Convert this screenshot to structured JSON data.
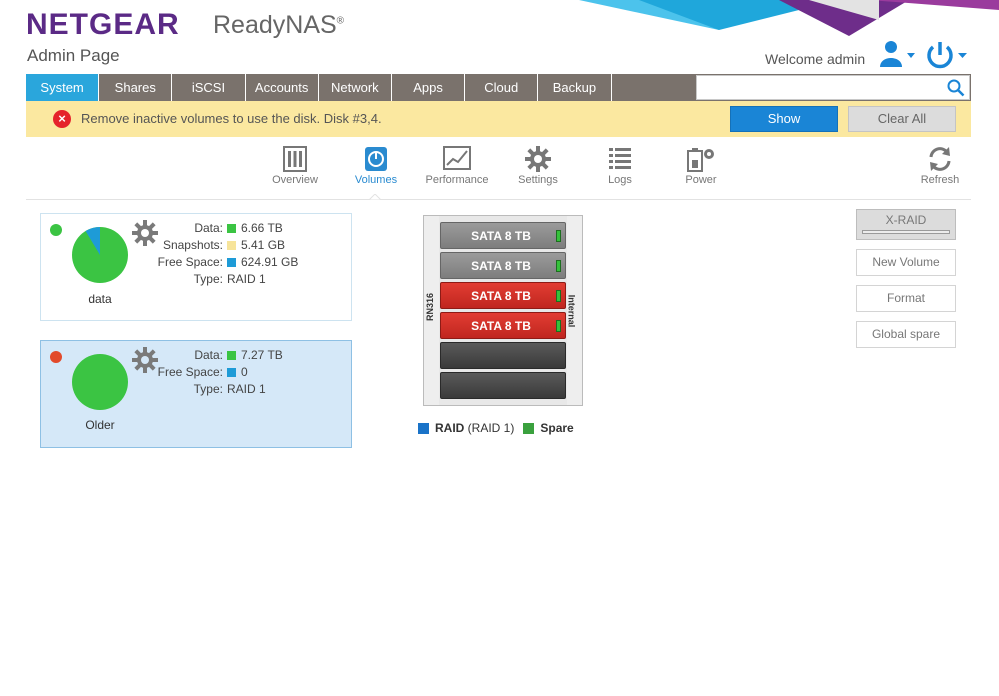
{
  "header": {
    "brand": "NETGEAR",
    "product": "ReadyNAS",
    "product_mark": "®",
    "page_title": "Admin Page",
    "welcome": "Welcome admin"
  },
  "nav": {
    "tabs": [
      {
        "label": "System",
        "active": true
      },
      {
        "label": "Shares"
      },
      {
        "label": "iSCSI"
      },
      {
        "label": "Accounts"
      },
      {
        "label": "Network"
      },
      {
        "label": "Apps"
      },
      {
        "label": "Cloud"
      },
      {
        "label": "Backup"
      }
    ],
    "search_value": ""
  },
  "alert": {
    "message": "Remove inactive volumes to use the disk. Disk #3,4.",
    "show_label": "Show",
    "clear_label": "Clear All"
  },
  "subtabs": [
    {
      "label": "Overview",
      "icon": "overview-icon"
    },
    {
      "label": "Volumes",
      "icon": "volumes-icon",
      "active": true
    },
    {
      "label": "Performance",
      "icon": "performance-icon"
    },
    {
      "label": "Settings",
      "icon": "settings-icon"
    },
    {
      "label": "Logs",
      "icon": "logs-icon"
    },
    {
      "label": "Power",
      "icon": "power-settings-icon"
    },
    {
      "label": "Refresh",
      "icon": "refresh-icon"
    }
  ],
  "volumes": [
    {
      "name": "data",
      "status_color": "#3bc443",
      "selected": false,
      "rows": [
        {
          "key": "Data:",
          "value": "6.66 TB",
          "color": "#3bc443"
        },
        {
          "key": "Snapshots:",
          "value": "5.41 GB",
          "color": "#f7e49a"
        },
        {
          "key": "Free Space:",
          "value": "624.91 GB",
          "color": "#1e9bd7"
        },
        {
          "key": "Type:",
          "value": "RAID 1"
        }
      ],
      "pie": [
        {
          "label": "Data",
          "fraction": 0.914,
          "color": "#3bc443"
        },
        {
          "label": "Free Space",
          "fraction": 0.086,
          "color": "#1e9bd7"
        }
      ]
    },
    {
      "name": "Older",
      "status_color": "#e24a2b",
      "selected": true,
      "rows": [
        {
          "key": "Data:",
          "value": "7.27 TB",
          "color": "#3bc443"
        },
        {
          "key": "Free Space:",
          "value": "0",
          "color": "#1e9bd7"
        },
        {
          "key": "Type:",
          "value": "RAID 1"
        }
      ],
      "pie": [
        {
          "label": "Data",
          "fraction": 1.0,
          "color": "#3bc443"
        }
      ]
    }
  ],
  "enclosure": {
    "model": "RN316",
    "side_label": "Internal",
    "bays": [
      {
        "label": "SATA 8 TB",
        "state": "gray"
      },
      {
        "label": "SATA 8 TB",
        "state": "gray"
      },
      {
        "label": "SATA 8 TB",
        "state": "red"
      },
      {
        "label": "SATA 8 TB",
        "state": "red"
      },
      {
        "label": "",
        "state": "empty"
      },
      {
        "label": "",
        "state": "empty"
      }
    ],
    "legend": {
      "raid_label": "RAID",
      "raid_detail": " (RAID 1)",
      "spare_label": "Spare",
      "raid_color": "#1a73c8",
      "spare_color": "#3aa13e"
    }
  },
  "actions": {
    "xraid": "X-RAID",
    "new_volume": "New Volume",
    "format": "Format",
    "global_spare": "Global spare"
  },
  "colors": {
    "accent": "#2aa6dc",
    "nav_bg": "#7a726c",
    "alert_bg": "#fbe8a0",
    "brand": "#5b2a86"
  }
}
